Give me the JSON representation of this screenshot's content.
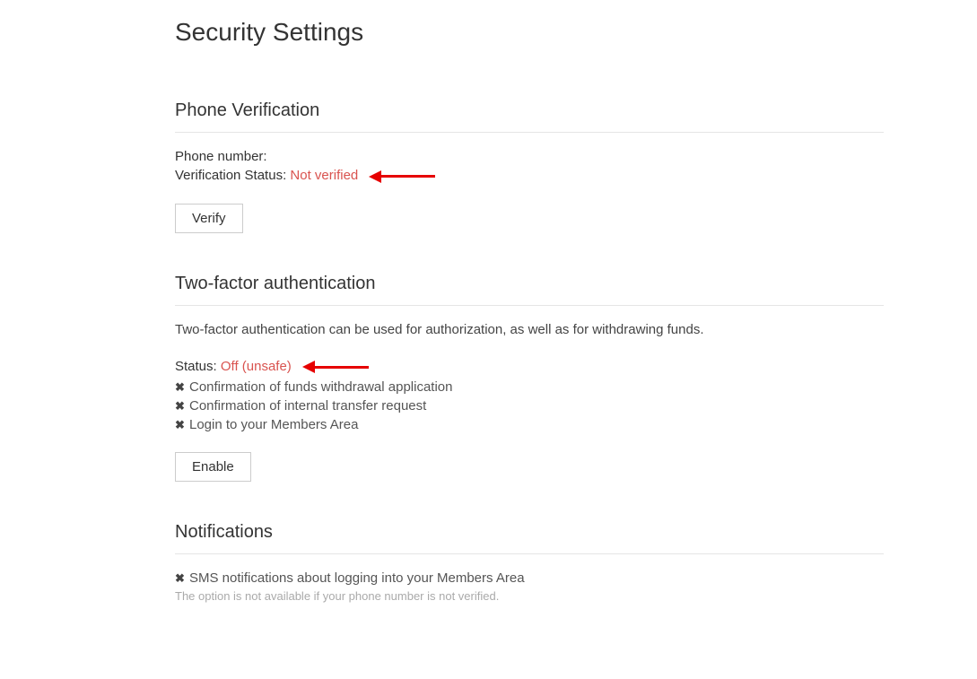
{
  "page": {
    "title": "Security Settings"
  },
  "phone_verification": {
    "heading": "Phone Verification",
    "phone_label": "Phone number:",
    "phone_value": "",
    "status_label": "Verification Status:",
    "status_value": "Not verified",
    "verify_button": "Verify"
  },
  "two_factor": {
    "heading": "Two-factor authentication",
    "description": "Two-factor authentication can be used for authorization, as well as for withdrawing funds.",
    "status_label": "Status:",
    "status_value": "Off (unsafe)",
    "items": [
      "Confirmation of funds withdrawal application",
      "Confirmation of internal transfer request",
      "Login to your Members Area"
    ],
    "enable_button": "Enable"
  },
  "notifications": {
    "heading": "Notifications",
    "item": "SMS notifications about logging into your Members Area",
    "note": "The option is not available if your phone number is not verified."
  }
}
